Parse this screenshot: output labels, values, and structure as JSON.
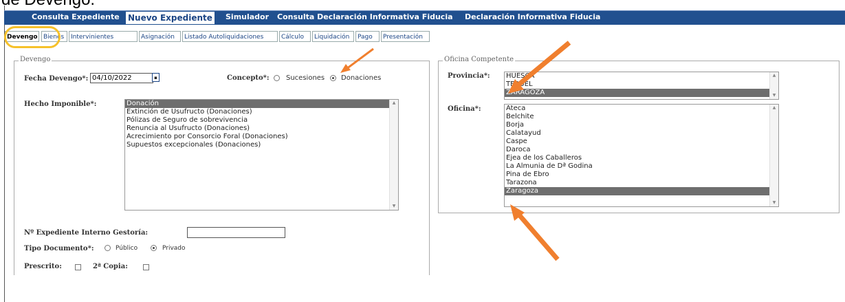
{
  "caption": "de Devengo.",
  "menu": [
    "Consulta Expediente",
    "Nuevo Expediente",
    "Simulador",
    "Consulta Declaración Informativa Fiducia",
    "Declaración Informativa Fiducia"
  ],
  "tabs": [
    "Devengo",
    "Bienes",
    "Intervinientes",
    "Asignación",
    "Listado Autoliquidaciones",
    "Cálculo",
    "Liquidación",
    "Pago",
    "Presentación"
  ],
  "devengo": {
    "legend": "Devengo",
    "fecha_label": "Fecha Devengo*:",
    "fecha_value": "04/10/2022",
    "concepto_label": "Concepto*:",
    "concepto_options": [
      "Sucesiones",
      "Donaciones"
    ],
    "concepto_selected": "Donaciones",
    "hecho_label": "Hecho Imponible*:",
    "hecho_options": [
      "Donación",
      "Extinción de Usufructo (Donaciones)",
      "Pólizas de Seguro de sobrevivencia",
      "Renuncia al Usufructo (Donaciones)",
      "Acrecimiento por Consorcio Foral (Donaciones)",
      "Supuestos excepcionales (Donaciones)"
    ],
    "hecho_selected": "Donación",
    "expediente_label": "Nº Expediente Interno Gestoría:",
    "expediente_value": "",
    "tipo_label": "Tipo Documento*:",
    "tipo_options": [
      "Público",
      "Privado"
    ],
    "tipo_selected": "Privado",
    "prescrito_label": "Prescrito:",
    "copia_label": "2ª Copia:"
  },
  "oficina": {
    "legend": "Oficina Competente",
    "provincia_label": "Provincia*:",
    "provincia_options": [
      "HUESCA",
      "TERUEL",
      "ZARAGOZA"
    ],
    "provincia_selected": "ZARAGOZA",
    "oficina_label": "Oficina*:",
    "oficina_options": [
      "Ateca",
      "Belchite",
      "Borja",
      "Calatayud",
      "Caspe",
      "Daroca",
      "Ejea de los Caballeros",
      "La Almunia de Dª Godina",
      "Pina de Ebro",
      "Tarazona",
      "Zaragoza"
    ],
    "oficina_selected": "Zaragoza"
  },
  "colors": {
    "menu_bg": "#21508f",
    "highlight": "#f6c12a",
    "arrow": "#f07f2e",
    "selected_option": "#6e6e6e"
  }
}
